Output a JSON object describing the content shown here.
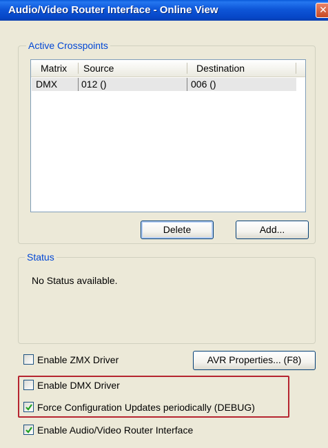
{
  "window": {
    "title": "Audio/Video Router Interface - Online View",
    "close_glyph": "✕"
  },
  "crosspoints": {
    "group_label": "Active Crosspoints",
    "columns": [
      "Matrix",
      "Source",
      "Destination"
    ],
    "rows": [
      {
        "matrix": "DMX",
        "source": "012 ()",
        "destination": "006 ()"
      }
    ],
    "delete_label": "Delete",
    "add_label": "Add..."
  },
  "status": {
    "group_label": "Status",
    "text": "No Status available."
  },
  "options": {
    "enable_zmx": {
      "label": "Enable ZMX Driver",
      "checked": false
    },
    "avr_properties_label": "AVR Properties... (F8)",
    "enable_dmx": {
      "label": "Enable DMX Driver",
      "checked": false
    },
    "force_config": {
      "label": "Force Configuration Updates periodically (DEBUG)",
      "checked": true
    },
    "enable_avr": {
      "label": "Enable Audio/Video Router Interface",
      "checked": true
    }
  },
  "colors": {
    "title_bar": "#0a56d6",
    "group_label": "#0046d5",
    "check_mark": "#21a121",
    "highlight_border": "#b5242f"
  }
}
